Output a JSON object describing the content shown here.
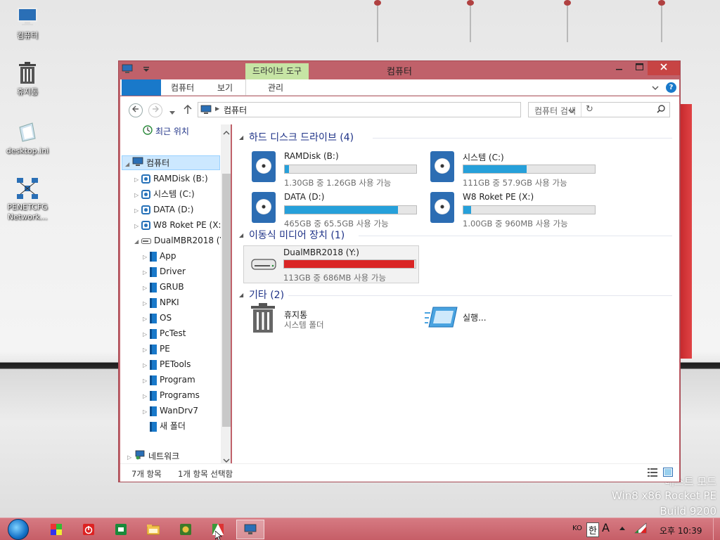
{
  "desktop": {
    "icons": [
      {
        "label": "컴퓨터",
        "icon": "computer-icon"
      },
      {
        "label": "휴지통",
        "icon": "recycle-bin-icon"
      },
      {
        "label": "desktop.ini",
        "icon": "ini-file-icon"
      },
      {
        "label": "PENETCFG\nNetwork...",
        "icon": "network-config-icon"
      }
    ],
    "watermark": {
      "line1": "테스트 모드",
      "line2": "Win8 x86 Rocket PE",
      "line3": "Build 9200"
    }
  },
  "window": {
    "title": "컴퓨터",
    "contextual_tab": "드라이브 도구",
    "ribbon_tabs": {
      "file": "",
      "computer": "컴퓨터",
      "view": "보기",
      "manage": "관리"
    },
    "address": {
      "path": "컴퓨터",
      "search_placeholder": "컴퓨터 검색"
    },
    "nav": {
      "recent": "최근 위치",
      "computer": "컴퓨터",
      "drives": [
        "RAMDisk (B:)",
        "시스템 (C:)",
        "DATA (D:)",
        "W8 Roket PE (X:)",
        "DualMBR2018 (Y:)"
      ],
      "folders": [
        "App",
        "Driver",
        "GRUB",
        "NPKI",
        "OS",
        "PcTest",
        "PE",
        "PETools",
        "Program",
        "Programs",
        "WanDrv7",
        "새 폴더"
      ],
      "network": "네트워크"
    },
    "groups": {
      "hdd": "하드 디스크 드라이브 (4)",
      "removable": "이동식 미디어 장치 (1)",
      "other": "기타 (2)"
    },
    "drives": [
      {
        "name": "RAMDisk (B:)",
        "free": "1.30GB 중 1.26GB 사용 가능",
        "used": 0.03
      },
      {
        "name": "시스템 (C:)",
        "free": "111GB 중 57.9GB 사용 가능",
        "used": 0.48
      },
      {
        "name": "DATA (D:)",
        "free": "465GB 중 65.5GB 사용 가능",
        "used": 0.86
      },
      {
        "name": "W8 Roket PE (X:)",
        "free": "1.00GB 중 960MB 사용 가능",
        "used": 0.06
      }
    ],
    "removable": {
      "name": "DualMBR2018 (Y:)",
      "free": "113GB 중 686MB 사용 가능",
      "used": 0.99
    },
    "other_items": [
      {
        "name": "휴지통",
        "sub": "시스템 폴더"
      },
      {
        "name": "실행...",
        "sub": ""
      }
    ],
    "status": {
      "count": "7개 항목",
      "selected": "1개 항목 선택함"
    }
  },
  "taskbar": {
    "tray": {
      "lang": "KO",
      "ime": "한",
      "font": "A",
      "clock": "오후 10:39"
    }
  },
  "colors": {
    "accent": "#1979ca",
    "window_frame": "#c0616a",
    "bar_normal": "#26a0da",
    "bar_full": "#da2626"
  }
}
